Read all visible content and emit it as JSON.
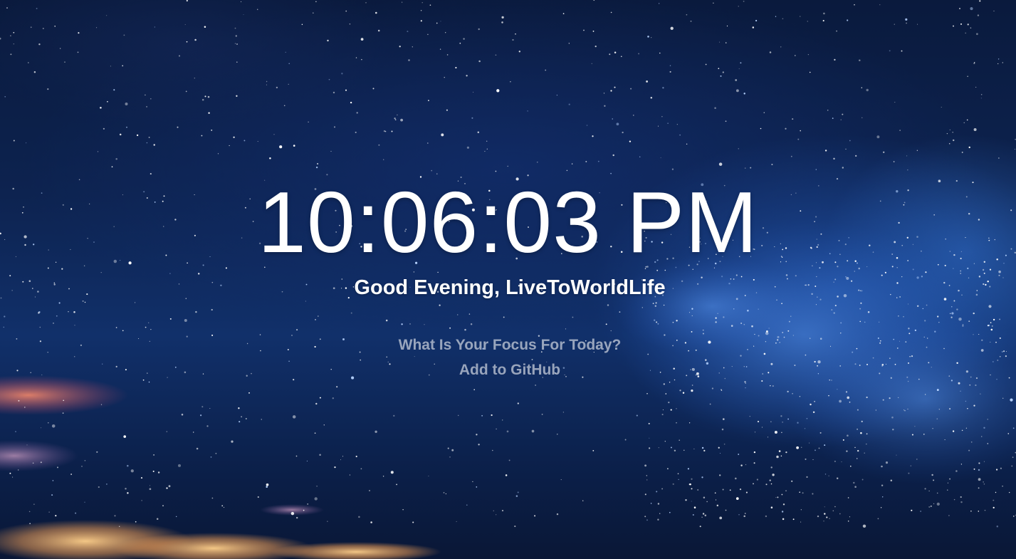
{
  "clock": {
    "time": "10:06:03 PM"
  },
  "greeting": {
    "text": "Good Evening, LiveToWorldLife"
  },
  "focus": {
    "prompt": "What Is Your Focus For Today?"
  },
  "github": {
    "link_label": "Add to GitHub"
  },
  "colors": {
    "sky_top": "#0a1a3d",
    "sky_mid": "#11306a",
    "text_primary": "#ffffff",
    "text_muted": "#cdd2de"
  }
}
